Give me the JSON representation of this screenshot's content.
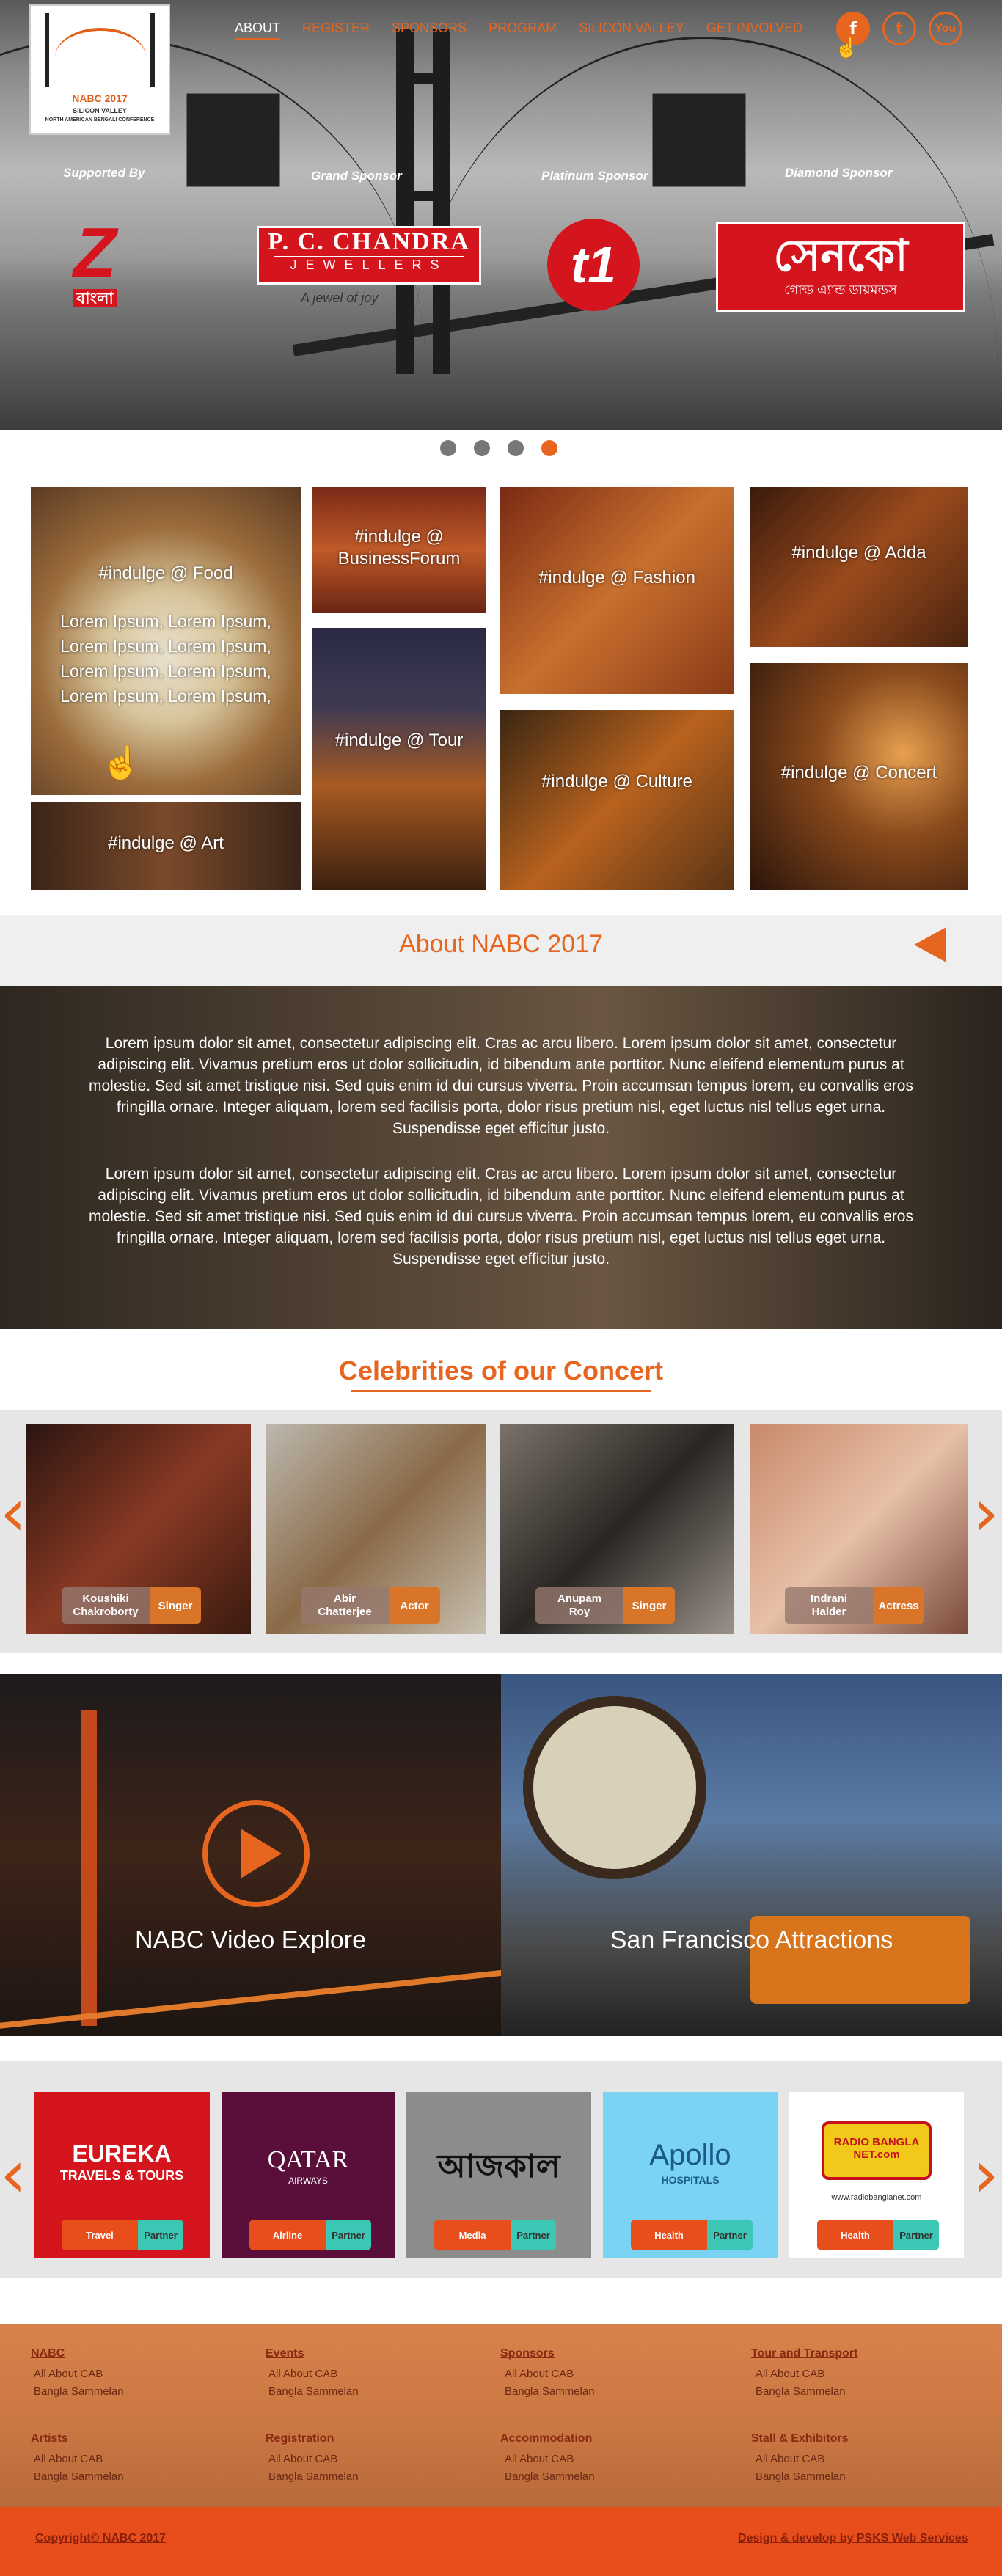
{
  "nav": {
    "items": [
      {
        "label": "ABOUT"
      },
      {
        "label": "REGISTER"
      },
      {
        "label": "SPONSORS"
      },
      {
        "label": "PROGRAM"
      },
      {
        "label": "SILICON VALLEY"
      },
      {
        "label": "GET INVOLVED"
      }
    ]
  },
  "logo": {
    "line1": "NABC 2017",
    "line2": "SILICON VALLEY",
    "line3": "NORTH AMERICAN BENGALI CONFERENCE"
  },
  "social": {
    "facebook": "f",
    "twitter": "t",
    "youtube": "You"
  },
  "sponsors": {
    "labels": [
      "Supported By",
      "Grand Sponsor",
      "Platinum Sponsor",
      "Diamond Sponsor"
    ],
    "zee": {
      "mark": "Z",
      "text": "বাংলা"
    },
    "pc": {
      "line1": "P. C. CHANDRA",
      "line2": "JEWELLERS",
      "tag": "A jewel of joy"
    },
    "t1": {
      "mark": "t1"
    },
    "senco": {
      "line1": "সেনকো",
      "line2": "গোল্ড এ্যান্ড ডায়মন্ডস"
    }
  },
  "tiles": {
    "food": "#indulge @ Food",
    "food_lorem": "Lorem Ipsum, Lorem Ipsum, Lorem Ipsum, Lorem Ipsum, Lorem Ipsum, Lorem Ipsum, Lorem Ipsum, Lorem Ipsum,",
    "business_1": "#indulge @",
    "business_2": "BusinessForum",
    "fashion": "#indulge @ Fashion",
    "adda": "#indulge @ Adda",
    "tour": "#indulge @ Tour",
    "culture": "#indulge @ Culture",
    "concert": "#indulge @ Concert",
    "art": "#indulge @ Art"
  },
  "about": {
    "title": "About NABC 2017",
    "para1": "Lorem ipsum dolor sit amet, consectetur adipiscing elit. Cras ac arcu libero. Lorem ipsum dolor sit amet, consectetur adipiscing elit. Vivamus pretium eros ut dolor sollicitudin, id bibendum ante porttitor. Nunc eleifend elementum purus at molestie. Sed sit amet tristique nisi. Sed quis enim id dui cursus viverra. Proin accumsan tempus lorem, eu convallis eros fringilla ornare. Integer aliquam, lorem sed facilisis porta, dolor risus pretium nisl, eget luctus nisl tellus eget urna. Suspendisse eget efficitur justo.",
    "para2": "Lorem ipsum dolor sit amet, consectetur adipiscing elit. Cras ac arcu libero. Lorem ipsum dolor sit amet, consectetur adipiscing elit. Vivamus pretium eros ut dolor sollicitudin, id bibendum ante porttitor. Nunc eleifend elementum purus at molestie. Sed sit amet tristique nisi. Sed quis enim id dui cursus viverra. Proin accumsan tempus lorem, eu convallis eros fringilla ornare. Integer aliquam, lorem sed facilisis porta, dolor risus pretium nisl, eget luctus nisl tellus eget urna. Suspendisse eget efficitur justo."
  },
  "celebs": {
    "title": "Celebrities of our Concert",
    "items": [
      {
        "name1": "Koushiki",
        "name2": "Chakroborty",
        "role": "Singer"
      },
      {
        "name1": "Abir",
        "name2": "Chatterjee",
        "role": "Actor"
      },
      {
        "name1": "Anupam",
        "name2": "Roy",
        "role": "Singer"
      },
      {
        "name1": "Indrani",
        "name2": "Halder",
        "role": "Actress"
      }
    ]
  },
  "video": {
    "caption": "NABC Video Explore"
  },
  "sf": {
    "caption": "San Francisco Attractions"
  },
  "partners": {
    "items": [
      {
        "logo1": "EUREKA",
        "logo2": "TRAVELS & TOURS",
        "type": "Travel",
        "role": "Partner"
      },
      {
        "logo1": "QATAR",
        "logo2": "AIRWAYS",
        "type": "Airline",
        "role": "Partner"
      },
      {
        "logo1": "আজকাল",
        "logo2": "",
        "type": "Media",
        "role": "Partner"
      },
      {
        "logo1": "Apollo",
        "logo2": "HOSPITALS",
        "type": "Health",
        "role": "Partner"
      },
      {
        "logo1": "RADIO BANGLA NET.com",
        "logo2": "www.radiobanglanet.com",
        "type": "Health",
        "role": "Partner"
      }
    ]
  },
  "footer": {
    "cols": [
      {
        "h1": "NABC",
        "a": "All About CAB",
        "b": "Bangla Sammelan",
        "h2": "Artists",
        "c": "All About CAB",
        "d": "Bangla Sammelan"
      },
      {
        "h1": "Events",
        "a": "All About CAB",
        "b": "Bangla Sammelan",
        "h2": "Registration",
        "c": "All About CAB",
        "d": "Bangla Sammelan"
      },
      {
        "h1": "Sponsors",
        "a": "All About CAB",
        "b": "Bangla Sammelan",
        "h2": "Accommodation",
        "c": "All About CAB",
        "d": "Bangla Sammelan"
      },
      {
        "h1": "Tour and Transport",
        "a": "All About CAB",
        "b": "Bangla Sammelan",
        "h2": "Stall & Exhibitors",
        "c": "All About CAB",
        "d": "Bangla Sammelan"
      }
    ],
    "copyright": "Copyright© NABC 2017",
    "credit": "Design & develop by PSKS Web Services"
  },
  "colors": {
    "accent": "#e7661f",
    "footer": "#d9824b",
    "bottombar": "#e74e1c"
  }
}
